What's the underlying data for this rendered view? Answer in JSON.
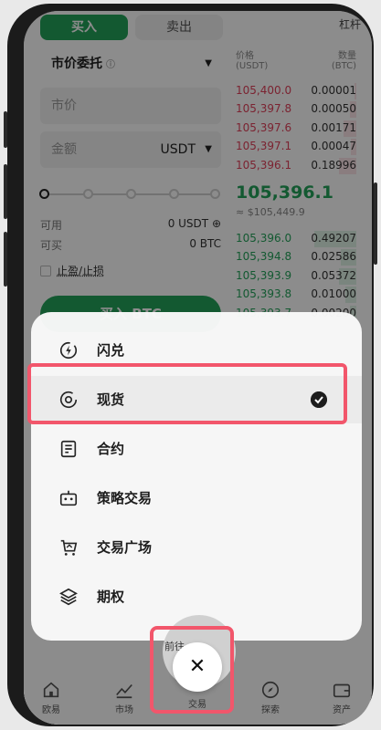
{
  "trade_panel": {
    "tab_buy": "买入",
    "tab_sell": "卖出",
    "tab_more": "杠杆",
    "order_type": "市价委托",
    "order_type_info": "ⓘ",
    "price_placeholder": "市价",
    "amount_placeholder": "金额",
    "amount_unit": "USDT",
    "available_label": "可用",
    "available_value": "0 USDT",
    "can_buy_label": "可买",
    "can_buy_value": "0 BTC",
    "tp_sl_label": "止盈/止损",
    "buy_button": "买入 BTC"
  },
  "order_book": {
    "price_header": "价格",
    "price_unit": "(USDT)",
    "qty_header": "数量",
    "qty_unit": "(BTC)",
    "asks": [
      {
        "price": "105,400.0",
        "qty": "0.00001",
        "depth": 0.05
      },
      {
        "price": "105,397.8",
        "qty": "0.00050",
        "depth": 0.15
      },
      {
        "price": "105,397.6",
        "qty": "0.00171",
        "depth": 0.3
      },
      {
        "price": "105,397.1",
        "qty": "0.00047",
        "depth": 0.12
      },
      {
        "price": "105,396.1",
        "qty": "0.18996",
        "depth": 0.4
      }
    ],
    "last_price": "105,396.1",
    "last_price_usd": "≈ $105,449.9",
    "bids": [
      {
        "price": "105,396.0",
        "qty": "0.49207",
        "depth": 0.95
      },
      {
        "price": "105,394.8",
        "qty": "0.02586",
        "depth": 0.35
      },
      {
        "price": "105,393.9",
        "qty": "0.05372",
        "depth": 0.4
      },
      {
        "price": "105,393.8",
        "qty": "0.01000",
        "depth": 0.25
      },
      {
        "price": "105,393.7",
        "qty": "0.00200",
        "depth": 0.15
      }
    ],
    "ask_color": "#e0405a",
    "bid_color": "#23a35a"
  },
  "menu": {
    "items": [
      {
        "label": "闪兑",
        "icon": "flash-swap-icon"
      },
      {
        "label": "现货",
        "icon": "spot-icon",
        "selected": true
      },
      {
        "label": "合约",
        "icon": "futures-icon"
      },
      {
        "label": "策略交易",
        "icon": "bot-icon"
      },
      {
        "label": "交易广场",
        "icon": "marketplace-icon"
      },
      {
        "label": "期权",
        "icon": "options-layers-icon"
      }
    ],
    "prev_link": "前往… >",
    "close_label": "交易",
    "highlight_color": "#f2566b"
  },
  "bottom_nav": {
    "items": [
      {
        "label": "欧易",
        "icon": "home-icon"
      },
      {
        "label": "市场",
        "icon": "market-chart-icon"
      },
      {
        "label": "交易",
        "icon": "trade-icon"
      },
      {
        "label": "探索",
        "icon": "compass-icon"
      },
      {
        "label": "资产",
        "icon": "wallet-icon"
      }
    ]
  }
}
